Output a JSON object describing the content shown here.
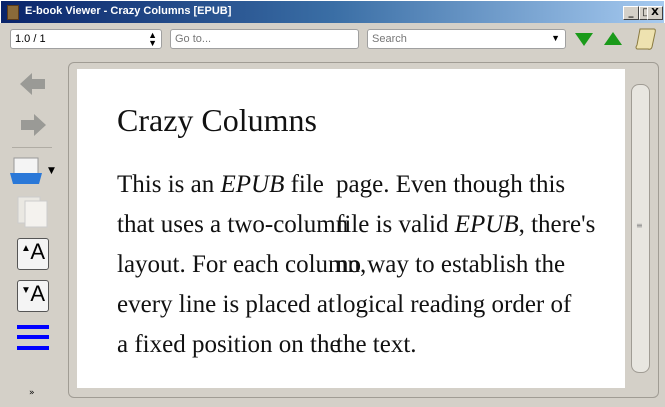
{
  "window": {
    "title": "E-book Viewer - Crazy Columns [EPUB]",
    "controls": [
      "_",
      "□",
      "X"
    ]
  },
  "toolbar": {
    "position": "1.0 / 1",
    "goto_placeholder": "Go to...",
    "search_placeholder": "Search"
  },
  "sidebar": {
    "icons": [
      "back-icon",
      "forward-icon",
      "open-book-icon",
      "copy-icon",
      "font-increase-icon",
      "font-decrease-icon",
      "toc-icon",
      "more-icon"
    ]
  },
  "book": {
    "title": "Crazy Columns",
    "col1": [
      [
        "This is an ",
        "EPUB",
        " file"
      ],
      [
        "that uses a two-column",
        "",
        ""
      ],
      [
        "layout. For each column,",
        "",
        ""
      ],
      [
        "every line is placed at",
        "",
        ""
      ],
      [
        "a fixed position on the",
        "",
        ""
      ]
    ],
    "col2": [
      [
        "page. Even though this",
        "",
        ""
      ],
      [
        "file is valid ",
        "EPUB",
        ", there's"
      ],
      [
        "no way to establish the",
        "",
        ""
      ],
      [
        "logical reading order of",
        "",
        ""
      ],
      [
        "the text.",
        "",
        ""
      ]
    ]
  },
  "colors": {
    "accent": "#0000ff",
    "find_arrows": "#1a9a1a"
  }
}
